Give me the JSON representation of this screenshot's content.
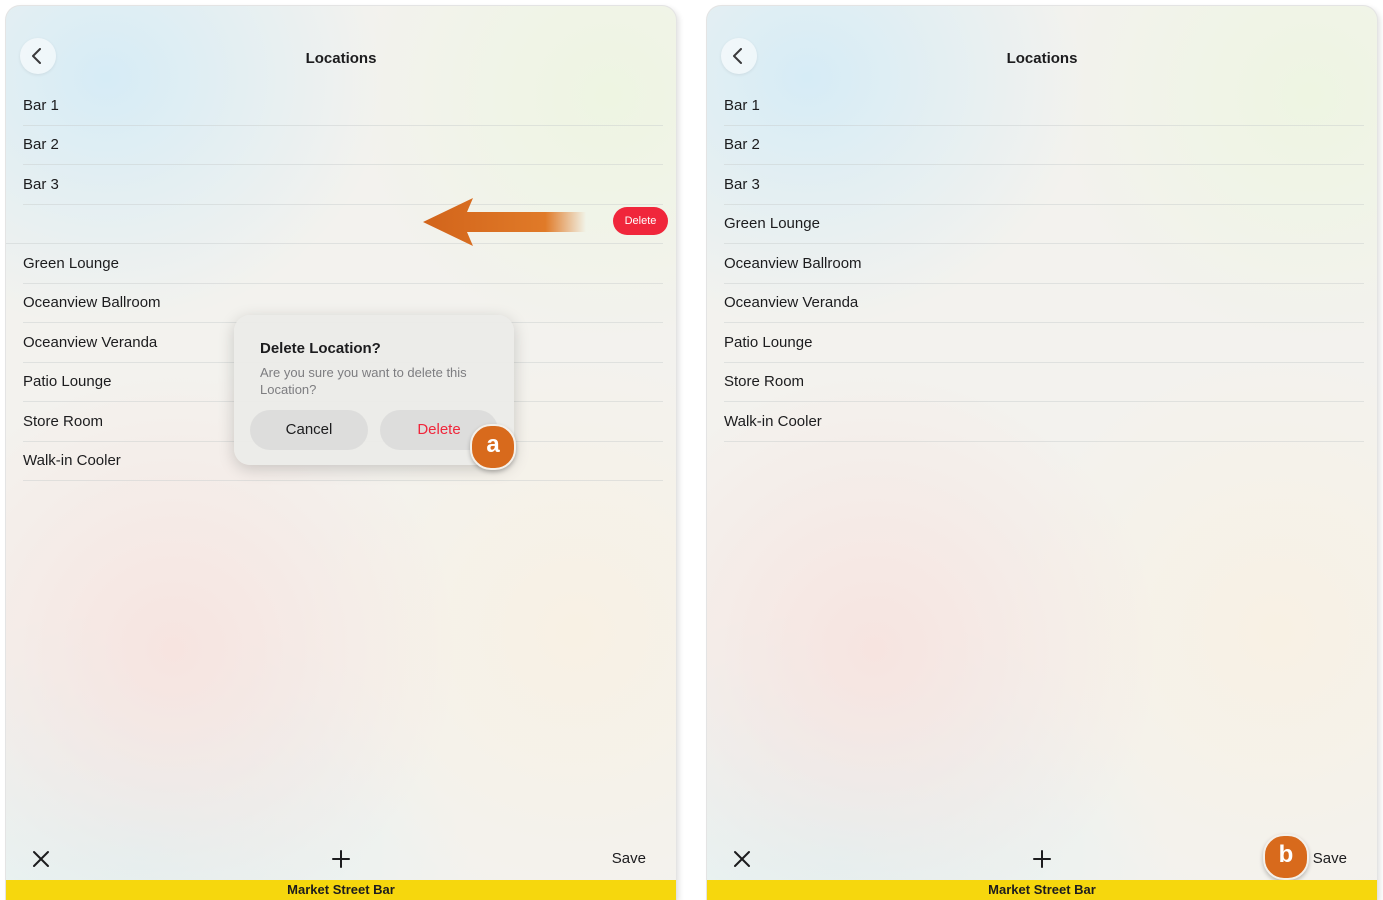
{
  "left": {
    "title": "Locations",
    "rows": [
      "Bar 1",
      "Bar 2",
      "Bar 3",
      "",
      "Green Lounge",
      "Oceanview Ballroom",
      "Oceanview Veranda",
      "Patio Lounge",
      "Store Room",
      "Walk-in Cooler"
    ],
    "swipe_delete_label": "Delete",
    "dialog": {
      "title": "Delete Location?",
      "message": "Are you sure you want to delete this Location?",
      "cancel_label": "Cancel",
      "delete_label": "Delete"
    },
    "badge": "a",
    "save_label": "Save",
    "venue_name": "Market Street Bar"
  },
  "right": {
    "title": "Locations",
    "rows": [
      "Bar 1",
      "Bar 2",
      "Bar 3",
      "Green Lounge",
      "Oceanview Ballroom",
      "Oceanview Veranda",
      "Patio Lounge",
      "Store Room",
      "Walk-in Cooler"
    ],
    "badge": "b",
    "save_label": "Save",
    "venue_name": "Market Street Bar"
  },
  "colors": {
    "accent_yellow": "#f6d70d",
    "delete_red": "#f0263b",
    "annotation_orange": "#d86a1c"
  },
  "icons": [
    "chevron-left-icon",
    "close-icon",
    "plus-icon",
    "left-arrow-annotation"
  ]
}
